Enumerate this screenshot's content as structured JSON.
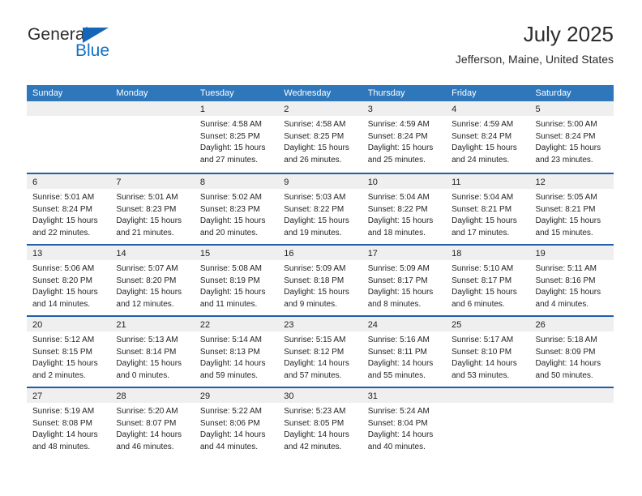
{
  "brand": {
    "name_part1": "General",
    "name_part2": "Blue",
    "triangle_color": "#1565b8",
    "blue_color": "#1271c4"
  },
  "header": {
    "title": "July 2025",
    "subtitle": "Jefferson, Maine, United States"
  },
  "theme": {
    "header_blue": "#2e77bb",
    "separator_blue": "#1f5fa9",
    "day_band_gray": "#efefef",
    "text": "#231f20"
  },
  "weekdays": [
    "Sunday",
    "Monday",
    "Tuesday",
    "Wednesday",
    "Thursday",
    "Friday",
    "Saturday"
  ],
  "weeks": [
    [
      {
        "day": "",
        "lines": []
      },
      {
        "day": "",
        "lines": []
      },
      {
        "day": "1",
        "lines": [
          "Sunrise: 4:58 AM",
          "Sunset: 8:25 PM",
          "Daylight: 15 hours",
          "and 27 minutes."
        ]
      },
      {
        "day": "2",
        "lines": [
          "Sunrise: 4:58 AM",
          "Sunset: 8:25 PM",
          "Daylight: 15 hours",
          "and 26 minutes."
        ]
      },
      {
        "day": "3",
        "lines": [
          "Sunrise: 4:59 AM",
          "Sunset: 8:24 PM",
          "Daylight: 15 hours",
          "and 25 minutes."
        ]
      },
      {
        "day": "4",
        "lines": [
          "Sunrise: 4:59 AM",
          "Sunset: 8:24 PM",
          "Daylight: 15 hours",
          "and 24 minutes."
        ]
      },
      {
        "day": "5",
        "lines": [
          "Sunrise: 5:00 AM",
          "Sunset: 8:24 PM",
          "Daylight: 15 hours",
          "and 23 minutes."
        ]
      }
    ],
    [
      {
        "day": "6",
        "lines": [
          "Sunrise: 5:01 AM",
          "Sunset: 8:24 PM",
          "Daylight: 15 hours",
          "and 22 minutes."
        ]
      },
      {
        "day": "7",
        "lines": [
          "Sunrise: 5:01 AM",
          "Sunset: 8:23 PM",
          "Daylight: 15 hours",
          "and 21 minutes."
        ]
      },
      {
        "day": "8",
        "lines": [
          "Sunrise: 5:02 AM",
          "Sunset: 8:23 PM",
          "Daylight: 15 hours",
          "and 20 minutes."
        ]
      },
      {
        "day": "9",
        "lines": [
          "Sunrise: 5:03 AM",
          "Sunset: 8:22 PM",
          "Daylight: 15 hours",
          "and 19 minutes."
        ]
      },
      {
        "day": "10",
        "lines": [
          "Sunrise: 5:04 AM",
          "Sunset: 8:22 PM",
          "Daylight: 15 hours",
          "and 18 minutes."
        ]
      },
      {
        "day": "11",
        "lines": [
          "Sunrise: 5:04 AM",
          "Sunset: 8:21 PM",
          "Daylight: 15 hours",
          "and 17 minutes."
        ]
      },
      {
        "day": "12",
        "lines": [
          "Sunrise: 5:05 AM",
          "Sunset: 8:21 PM",
          "Daylight: 15 hours",
          "and 15 minutes."
        ]
      }
    ],
    [
      {
        "day": "13",
        "lines": [
          "Sunrise: 5:06 AM",
          "Sunset: 8:20 PM",
          "Daylight: 15 hours",
          "and 14 minutes."
        ]
      },
      {
        "day": "14",
        "lines": [
          "Sunrise: 5:07 AM",
          "Sunset: 8:20 PM",
          "Daylight: 15 hours",
          "and 12 minutes."
        ]
      },
      {
        "day": "15",
        "lines": [
          "Sunrise: 5:08 AM",
          "Sunset: 8:19 PM",
          "Daylight: 15 hours",
          "and 11 minutes."
        ]
      },
      {
        "day": "16",
        "lines": [
          "Sunrise: 5:09 AM",
          "Sunset: 8:18 PM",
          "Daylight: 15 hours",
          "and 9 minutes."
        ]
      },
      {
        "day": "17",
        "lines": [
          "Sunrise: 5:09 AM",
          "Sunset: 8:17 PM",
          "Daylight: 15 hours",
          "and 8 minutes."
        ]
      },
      {
        "day": "18",
        "lines": [
          "Sunrise: 5:10 AM",
          "Sunset: 8:17 PM",
          "Daylight: 15 hours",
          "and 6 minutes."
        ]
      },
      {
        "day": "19",
        "lines": [
          "Sunrise: 5:11 AM",
          "Sunset: 8:16 PM",
          "Daylight: 15 hours",
          "and 4 minutes."
        ]
      }
    ],
    [
      {
        "day": "20",
        "lines": [
          "Sunrise: 5:12 AM",
          "Sunset: 8:15 PM",
          "Daylight: 15 hours",
          "and 2 minutes."
        ]
      },
      {
        "day": "21",
        "lines": [
          "Sunrise: 5:13 AM",
          "Sunset: 8:14 PM",
          "Daylight: 15 hours",
          "and 0 minutes."
        ]
      },
      {
        "day": "22",
        "lines": [
          "Sunrise: 5:14 AM",
          "Sunset: 8:13 PM",
          "Daylight: 14 hours",
          "and 59 minutes."
        ]
      },
      {
        "day": "23",
        "lines": [
          "Sunrise: 5:15 AM",
          "Sunset: 8:12 PM",
          "Daylight: 14 hours",
          "and 57 minutes."
        ]
      },
      {
        "day": "24",
        "lines": [
          "Sunrise: 5:16 AM",
          "Sunset: 8:11 PM",
          "Daylight: 14 hours",
          "and 55 minutes."
        ]
      },
      {
        "day": "25",
        "lines": [
          "Sunrise: 5:17 AM",
          "Sunset: 8:10 PM",
          "Daylight: 14 hours",
          "and 53 minutes."
        ]
      },
      {
        "day": "26",
        "lines": [
          "Sunrise: 5:18 AM",
          "Sunset: 8:09 PM",
          "Daylight: 14 hours",
          "and 50 minutes."
        ]
      }
    ],
    [
      {
        "day": "27",
        "lines": [
          "Sunrise: 5:19 AM",
          "Sunset: 8:08 PM",
          "Daylight: 14 hours",
          "and 48 minutes."
        ]
      },
      {
        "day": "28",
        "lines": [
          "Sunrise: 5:20 AM",
          "Sunset: 8:07 PM",
          "Daylight: 14 hours",
          "and 46 minutes."
        ]
      },
      {
        "day": "29",
        "lines": [
          "Sunrise: 5:22 AM",
          "Sunset: 8:06 PM",
          "Daylight: 14 hours",
          "and 44 minutes."
        ]
      },
      {
        "day": "30",
        "lines": [
          "Sunrise: 5:23 AM",
          "Sunset: 8:05 PM",
          "Daylight: 14 hours",
          "and 42 minutes."
        ]
      },
      {
        "day": "31",
        "lines": [
          "Sunrise: 5:24 AM",
          "Sunset: 8:04 PM",
          "Daylight: 14 hours",
          "and 40 minutes."
        ]
      },
      {
        "day": "",
        "lines": []
      },
      {
        "day": "",
        "lines": []
      }
    ]
  ]
}
